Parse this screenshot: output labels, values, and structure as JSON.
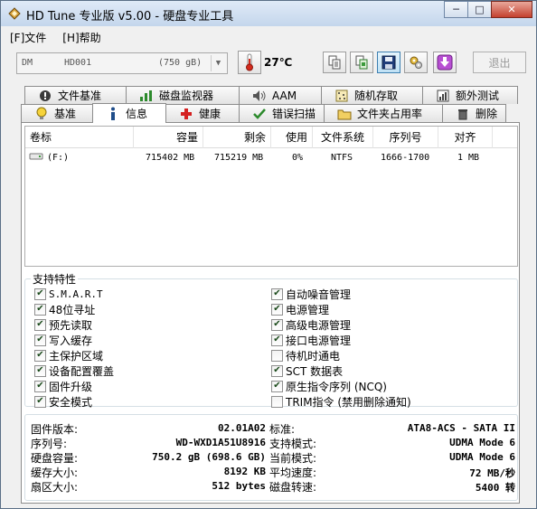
{
  "window": {
    "title": "HD Tune 专业版 v5.00 - 硬盘专业工具",
    "minimize": "─",
    "maximize": "□",
    "close": "✕"
  },
  "menu": [
    {
      "label": "[F]文件"
    },
    {
      "label": "[H]帮助"
    }
  ],
  "toolbar": {
    "drive": {
      "part1": "DM",
      "part2": "HD001",
      "part3": "(750 gB)"
    },
    "temperature": "27℃",
    "exit_label": "退出",
    "icons": [
      "copy-icon",
      "copy-screenshot-icon",
      "save-icon",
      "options-icon",
      "download-icon"
    ]
  },
  "tabs_top": [
    {
      "label": "文件基准",
      "icon": "file-benchmark-icon"
    },
    {
      "label": "磁盘监视器",
      "icon": "disk-monitor-icon"
    },
    {
      "label": "AAM",
      "icon": "speaker-icon"
    },
    {
      "label": "随机存取",
      "icon": "random-access-icon"
    },
    {
      "label": "额外测试",
      "icon": "extra-tests-icon"
    }
  ],
  "tabs_bottom": [
    {
      "label": "基准",
      "icon": "lightbulb-icon"
    },
    {
      "label": "信息",
      "icon": "info-icon",
      "active": true
    },
    {
      "label": "健康",
      "icon": "health-cross-icon"
    },
    {
      "label": "错误扫描",
      "icon": "error-scan-icon"
    },
    {
      "label": "文件夹占用率",
      "icon": "folder-icon"
    },
    {
      "label": "删除",
      "icon": "trash-icon"
    }
  ],
  "volumes": {
    "columns": [
      "卷标",
      "容量",
      "剩余",
      "使用",
      "文件系统",
      "序列号",
      "对齐"
    ],
    "rows": [
      {
        "label": "(F:)",
        "capacity": "715402 MB",
        "free": "715219 MB",
        "used": "0%",
        "fs": "NTFS",
        "serial": "1666-1700",
        "align": "1 MB"
      }
    ]
  },
  "features": {
    "title": "支持特性",
    "left": [
      {
        "label": "S.M.A.R.T",
        "checked": true
      },
      {
        "label": "48位寻址",
        "checked": true
      },
      {
        "label": "预先读取",
        "checked": true
      },
      {
        "label": "写入缓存",
        "checked": true
      },
      {
        "label": "主保护区域",
        "checked": true
      },
      {
        "label": "设备配置覆盖",
        "checked": true
      },
      {
        "label": "固件升级",
        "checked": true
      },
      {
        "label": "安全模式",
        "checked": true
      }
    ],
    "right": [
      {
        "label": "自动噪音管理",
        "checked": true
      },
      {
        "label": "电源管理",
        "checked": true
      },
      {
        "label": "高级电源管理",
        "checked": true
      },
      {
        "label": "接口电源管理",
        "checked": true
      },
      {
        "label": "待机时通电",
        "checked": false
      },
      {
        "label": "SCT 数据表",
        "checked": true
      },
      {
        "label": "原生指令序列 (NCQ)",
        "checked": true
      },
      {
        "label": "TRIM指令 (禁用删除通知)",
        "checked": false
      }
    ]
  },
  "info": {
    "left": [
      {
        "label": "固件版本:",
        "value": "02.01A02"
      },
      {
        "label": "序列号:",
        "value": "WD-WXD1A51U8916"
      },
      {
        "label": "硬盘容量:",
        "value": "750.2 gB (698.6 GB)"
      },
      {
        "label": "缓存大小:",
        "value": "8192 KB"
      },
      {
        "label": "扇区大小:",
        "value": "512 bytes"
      }
    ],
    "right": [
      {
        "label": "标准:",
        "value": "ATA8-ACS - SATA II"
      },
      {
        "label": "支持模式:",
        "value": "UDMA Mode 6"
      },
      {
        "label": "当前模式:",
        "value": "UDMA Mode 6"
      },
      {
        "label": "平均速度:",
        "value": "72 MB/秒"
      },
      {
        "label": "磁盘转速:",
        "value": "5400 转"
      }
    ]
  }
}
